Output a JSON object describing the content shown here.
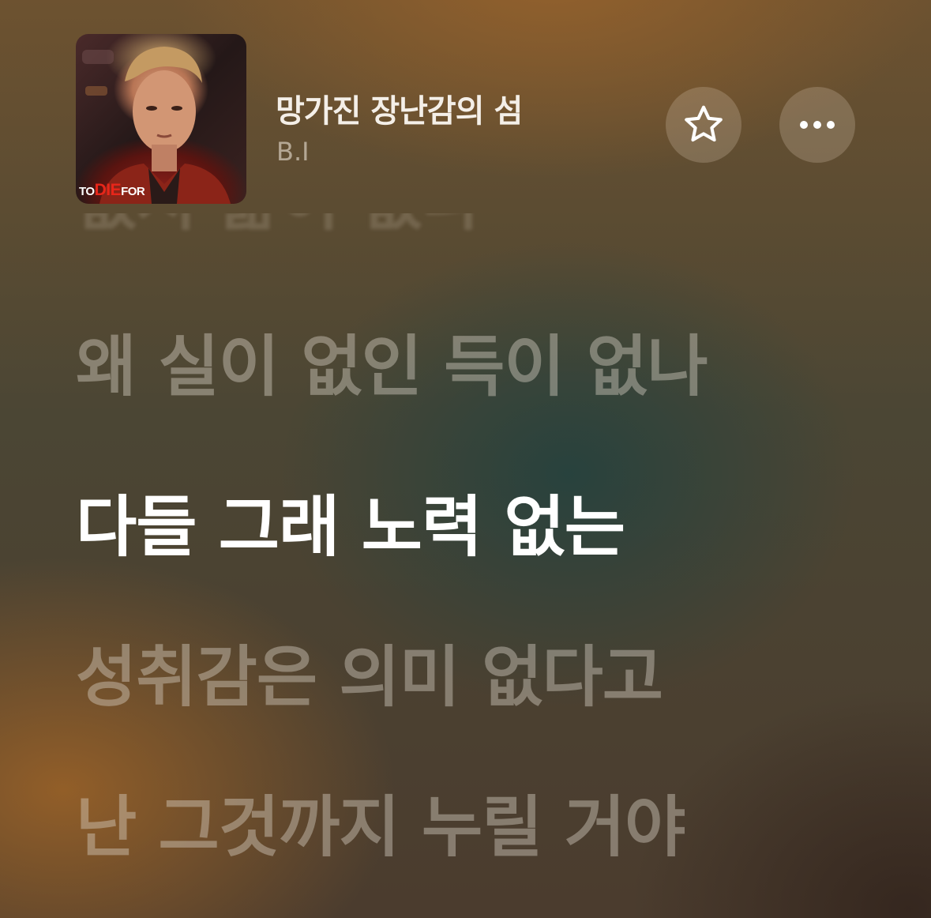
{
  "now_playing": {
    "title": "망가진 장난감의 섬",
    "artist": "B.I",
    "album_art_text": "TO DIE FOR"
  },
  "actions": {
    "favorite_icon": "star-icon",
    "more_icon": "ellipsis-icon"
  },
  "lyrics": {
    "lines": [
      "없지 삶이 없나",
      "왜 실이 없인 득이 없나",
      "다들 그래 노력 없는",
      "성취감은 의미 없다고",
      "난 그것까지 누릴 거야"
    ],
    "active_index": 2
  },
  "colors": {
    "active_lyric": "#ffffff",
    "button_bg": "rgba(210,190,170,0.28)"
  }
}
